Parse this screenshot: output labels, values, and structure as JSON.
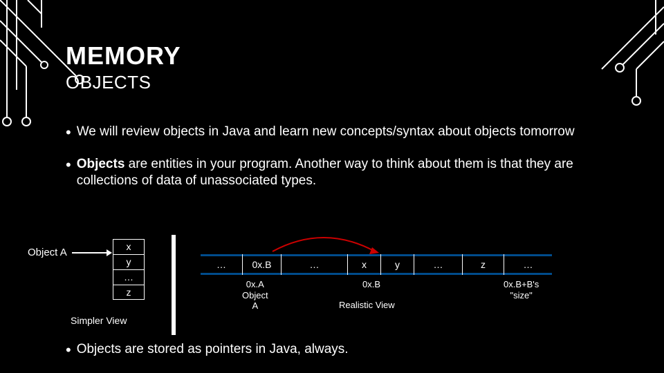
{
  "title": "MEMORY",
  "subtitle": "OBJECTS",
  "bullets": [
    {
      "text_before": "We will review objects in Java and learn new concepts/syntax about objects tomorrow",
      "bold_word": ""
    },
    {
      "bold_word": "Objects",
      "text_after": " are entities in your program. Another way to think about them is that they are collections of data of unassociated types."
    }
  ],
  "bullet3": "Objects are stored as pointers in Java, always.",
  "diagram": {
    "objectA_label": "Object A",
    "stack": [
      "x",
      "y",
      "…",
      "z"
    ],
    "simpler_label": "Simpler View",
    "memcells": [
      "…",
      "0x.B",
      "…",
      "x",
      "y",
      "…",
      "z",
      "…"
    ],
    "mem_label_a_line1": "0x.A",
    "mem_label_a_line2": "Object",
    "mem_label_a_line3": "A",
    "mem_label_b": "0x.B",
    "realistic_label": "Realistic View",
    "mem_label_end_line1": "0x.B+B's",
    "mem_label_end_line2": "\"size\""
  }
}
